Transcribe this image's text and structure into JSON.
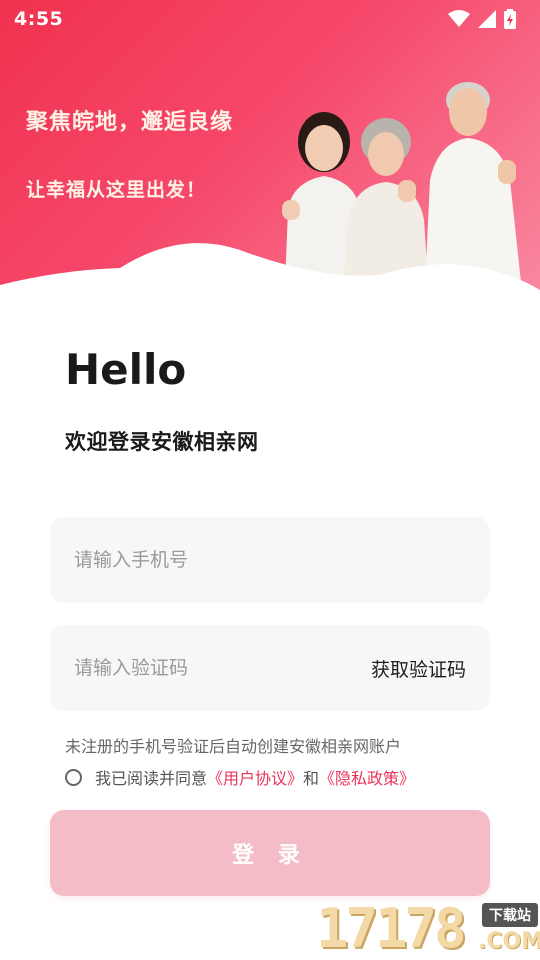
{
  "status_bar": {
    "time": "4:55"
  },
  "banner": {
    "slogan_main": "聚焦皖地，邂逅良缘",
    "slogan_sub": "让幸福从这里出发！"
  },
  "greeting": "Hello",
  "welcome": "欢迎登录安徽相亲网",
  "phone_input": {
    "placeholder": "请输入手机号",
    "value": ""
  },
  "code_input": {
    "placeholder": "请输入验证码",
    "value": "",
    "get_code_label": "获取验证码"
  },
  "notice": "未注册的手机号验证后自动创建安徽相亲网账户",
  "agreement": {
    "prefix": "我已阅读并同意",
    "user_agreement": "《用户协议》",
    "conjunction": "和",
    "privacy_policy": "《隐私政策》",
    "checked": false
  },
  "login_label": "登 录",
  "watermark": {
    "number": "17178",
    "domain": ".COM",
    "tag": "下载站"
  },
  "colors": {
    "accent": "#e8355a",
    "banner": "#f0324f",
    "login_disabled": "#f4bcc6"
  }
}
